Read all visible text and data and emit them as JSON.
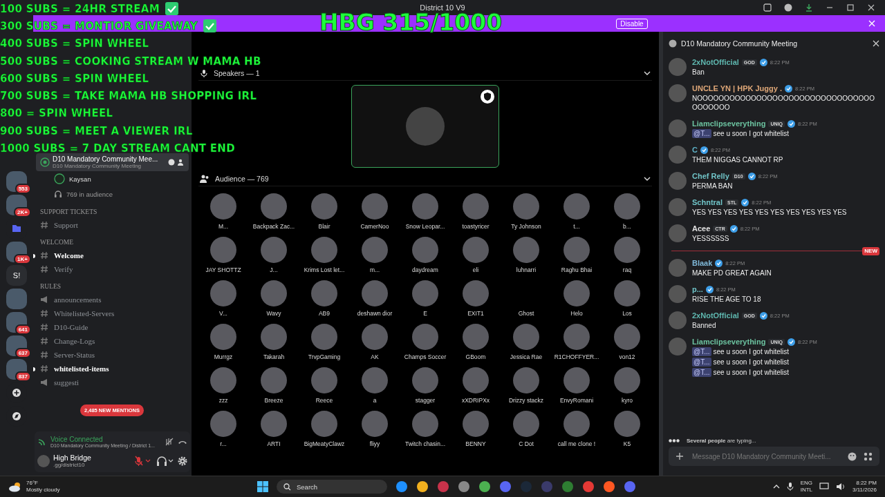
{
  "title_bar": {
    "title": "District 10 V9"
  },
  "overlay": {
    "goals": [
      {
        "text": "100 SUBS = 24HR STREAM",
        "checked": true
      },
      {
        "text": "300 SUBS = MONTIOR GIVEAWAY",
        "checked": true
      },
      {
        "text": "400 SUBS = SPIN WHEEL",
        "checked": false
      },
      {
        "text": "500 SUBS = COOKING STREAM W MAMA HB",
        "checked": false
      },
      {
        "text": "600 SUBS = SPIN WHEEL",
        "checked": false
      },
      {
        "text": "700 SUBS = TAKE MAMA HB SHOPPING IRL",
        "checked": false
      },
      {
        "text": "800 = SPIN WHEEL",
        "checked": false
      },
      {
        "text": "900 SUBS = MEET A VIEWER IRL",
        "checked": false
      },
      {
        "text": "1000 SUBS = 7 DAY STREAM CANT END",
        "checked": false
      }
    ],
    "counter": "HBG 315/1000"
  },
  "banner": {
    "button": "Disable"
  },
  "server_rail": [
    {
      "kind": "server",
      "badge": "553"
    },
    {
      "kind": "server",
      "badge": "2K+"
    },
    {
      "kind": "folder"
    },
    {
      "kind": "server",
      "badge": "1K+"
    },
    {
      "kind": "label",
      "label": "S!"
    },
    {
      "kind": "server"
    },
    {
      "kind": "server",
      "badge": "641"
    },
    {
      "kind": "server",
      "badge": "637"
    },
    {
      "kind": "server",
      "badge": "837"
    }
  ],
  "sidebar": {
    "stage": {
      "name": "D10 Mandatory Community Mee...",
      "subtitle": "D10 Mandatory Community Meeting",
      "selected": true,
      "speaker": "Kaysan",
      "audience": "769 in audience"
    },
    "categories": [
      {
        "name": "SUPPORT TICKETS",
        "channels": [
          {
            "name": "Support",
            "kind": "text",
            "unread": false
          }
        ]
      },
      {
        "name": "WELCOME",
        "channels": [
          {
            "name": "Welcome",
            "kind": "text",
            "unread": true
          },
          {
            "name": "Verify",
            "kind": "text",
            "unread": false
          }
        ]
      },
      {
        "name": "RULES",
        "channels": [
          {
            "name": "announcements",
            "kind": "announce",
            "unread": false
          },
          {
            "name": "Whitelisted-Servers",
            "kind": "text",
            "unread": false
          },
          {
            "name": "D10-Guide",
            "kind": "text",
            "unread": false
          },
          {
            "name": "Change-Logs",
            "kind": "text",
            "unread": false
          },
          {
            "name": "Server-Status",
            "kind": "text",
            "unread": false
          },
          {
            "name": "whitelisted-items",
            "kind": "text",
            "unread": true
          },
          {
            "name": "suggesti",
            "kind": "announce",
            "unread": false
          }
        ]
      }
    ],
    "mentions_badge": "2,485 NEW MENTIONS"
  },
  "voice": {
    "status": "Voice Connected",
    "channel": "D10 Mandatory Community Meeting / District 1...",
    "user": "High Bridge",
    "user_status": ".gg/district10",
    "muted": true
  },
  "stage": {
    "speakers_label": "Speakers — 1",
    "audience_label": "Audience — 769",
    "audience": [
      {
        "name": "M...",
        "avatar": true
      },
      {
        "name": "Backpack Zac...",
        "avatar": true
      },
      {
        "name": "Blair",
        "avatar": true
      },
      {
        "name": "CamerNoo",
        "avatar": true
      },
      {
        "name": "Snow Leopar...",
        "avatar": true
      },
      {
        "name": "toastyricer",
        "avatar": true
      },
      {
        "name": "Ty Johnson",
        "avatar": true
      },
      {
        "name": "t...",
        "avatar": true
      },
      {
        "name": "b...",
        "avatar": true
      },
      {
        "name": "JAY SHOTTZ",
        "avatar": true
      },
      {
        "name": "J...",
        "avatar": true
      },
      {
        "name": "Krims Lost let...",
        "avatar": true
      },
      {
        "name": "m...",
        "avatar": true
      },
      {
        "name": "daydream",
        "avatar": true
      },
      {
        "name": "eli",
        "avatar": true
      },
      {
        "name": "luhnarri",
        "avatar": true
      },
      {
        "name": "Raghu Bhai",
        "avatar": true
      },
      {
        "name": "raq",
        "avatar": true
      },
      {
        "name": "V...",
        "avatar": true
      },
      {
        "name": "Wavy",
        "avatar": true
      },
      {
        "name": "AB9",
        "avatar": true
      },
      {
        "name": "deshawn dior",
        "avatar": true
      },
      {
        "name": "E",
        "avatar": true
      },
      {
        "name": "EXIT1",
        "avatar": true
      },
      {
        "name": "Ghost",
        "avatar": false
      },
      {
        "name": "Helo",
        "avatar": true
      },
      {
        "name": "Los",
        "avatar": true
      },
      {
        "name": "Murrgz",
        "avatar": true
      },
      {
        "name": "Takarah",
        "avatar": true
      },
      {
        "name": "TrvpGaming",
        "avatar": true
      },
      {
        "name": "AK",
        "avatar": true
      },
      {
        "name": "Champs Soccer",
        "avatar": true
      },
      {
        "name": "GBoom",
        "avatar": true
      },
      {
        "name": "Jessica Rae",
        "avatar": true
      },
      {
        "name": "R1CHOFFYER...",
        "avatar": true
      },
      {
        "name": "von12",
        "avatar": true
      },
      {
        "name": "zzz",
        "avatar": true
      },
      {
        "name": "Breeze",
        "avatar": true
      },
      {
        "name": "Reece",
        "avatar": true
      },
      {
        "name": "a",
        "avatar": true
      },
      {
        "name": "stagger",
        "avatar": true
      },
      {
        "name": "xXDRIPXx",
        "avatar": true
      },
      {
        "name": "Drizzy stackz",
        "avatar": true
      },
      {
        "name": "EnvyRomani",
        "avatar": true
      },
      {
        "name": "kyro",
        "avatar": true
      },
      {
        "name": "r...",
        "avatar": true
      },
      {
        "name": "ARTI",
        "avatar": true
      },
      {
        "name": "BigMeatyClawz",
        "avatar": true
      },
      {
        "name": "fliyy",
        "avatar": true
      },
      {
        "name": "Twitch chasin...",
        "avatar": true
      },
      {
        "name": "BENNY",
        "avatar": true
      },
      {
        "name": "C Dot",
        "avatar": true
      },
      {
        "name": "call me clone !",
        "avatar": true
      },
      {
        "name": "K5",
        "avatar": true
      }
    ]
  },
  "chat": {
    "title": "D10 Mandatory Community Meeting",
    "messages": [
      {
        "kind": "message",
        "author": "2xNotOfficial",
        "color": "#5fb8b0",
        "tag": "GOD",
        "time": "8:22 PM",
        "lines": [
          {
            "text": "Ban"
          }
        ]
      },
      {
        "kind": "message",
        "author": "UNCLE YN | HPK Juggy .",
        "color": "#e0a878",
        "time": "8:22 PM",
        "lines": [
          {
            "text": "NOOOOOOOOOOOOOOOOOOOOOOOOOOOOOOOOOOOOOOOO"
          }
        ]
      },
      {
        "kind": "message",
        "author": "Liamclipseverything",
        "color": "#6cc3a0",
        "tag": "UNIQ",
        "time": "8:22 PM",
        "lines": [
          {
            "mention": "@T...",
            "text": "see u soon I got whitelist"
          }
        ]
      },
      {
        "kind": "message",
        "author": "C",
        "color": "#5fb3c8",
        "time": "8:22 PM",
        "lines": [
          {
            "text": "THEM NIGGAS CANNOT RP"
          }
        ]
      },
      {
        "kind": "message",
        "author": "Chef Relly",
        "color": "#70c4c8",
        "tag": "D10",
        "time": "8:22 PM",
        "lines": [
          {
            "text": "PERMA BAN"
          }
        ]
      },
      {
        "kind": "message",
        "author": "Schntral",
        "color": "#70c4c8",
        "tag": "STL",
        "time": "8:22 PM",
        "lines": [
          {
            "text": "YES YES YES YES YES YES YES YES YES YES"
          }
        ]
      },
      {
        "kind": "message",
        "author": "Acee",
        "color": "#e4e4e4",
        "tag": "CTR",
        "time": "8:22 PM",
        "lines": [
          {
            "text": "YESSSSSS"
          }
        ]
      },
      {
        "kind": "divider",
        "label": "NEW"
      },
      {
        "kind": "message",
        "author": "Blaak",
        "color": "#7fb8d8",
        "time": "8:22 PM",
        "lines": [
          {
            "text": "MAKE PD GREAT AGAIN"
          }
        ]
      },
      {
        "kind": "message",
        "author": "p...",
        "color": "#70c4c8",
        "time": "8:22 PM",
        "lines": [
          {
            "text": "RISE THE AGE TO 18"
          }
        ]
      },
      {
        "kind": "message",
        "author": "2xNotOfficial",
        "color": "#5fb8b0",
        "tag": "GOD",
        "time": "8:22 PM",
        "lines": [
          {
            "text": "Banned"
          }
        ]
      },
      {
        "kind": "message",
        "author": "Liamclipseverything",
        "color": "#6cc3a0",
        "tag": "UNIQ",
        "time": "8:22 PM",
        "lines": [
          {
            "mention": "@T...",
            "text": "see u soon I got whitelist"
          },
          {
            "mention": "@T...",
            "text": "see u soon I got whitelist"
          },
          {
            "mention": "@T...",
            "text": "see u soon I got whitelist"
          }
        ]
      }
    ],
    "typing": "**Several people** are typing...",
    "placeholder": "Message D10 Mandatory Community Meeti..."
  },
  "taskbar": {
    "temperature": "76°F",
    "weather": "Mostly cloudy",
    "search": "Search",
    "language": "ENG",
    "layout": "INTL",
    "time": "8:22 PM",
    "date": "3/11/2026"
  }
}
